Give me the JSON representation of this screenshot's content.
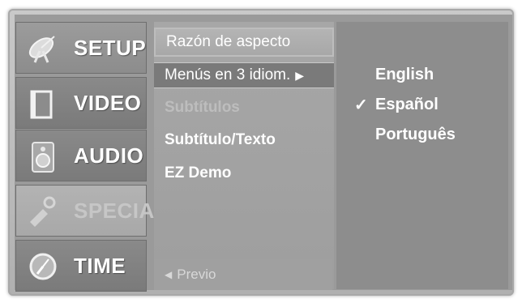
{
  "nav": {
    "items": [
      {
        "label": "SETUP",
        "icon": "satellite-dish-icon"
      },
      {
        "label": "VIDEO",
        "icon": "screen-icon"
      },
      {
        "label": "AUDIO",
        "icon": "speaker-icon"
      },
      {
        "label": "SPECIAL",
        "icon": "key-icon"
      },
      {
        "label": "TIME",
        "icon": "clock-icon"
      }
    ]
  },
  "submenu": {
    "items": [
      {
        "label": "Razón de aspecto"
      },
      {
        "label": "Menús en 3 idiom.",
        "arrow": "▶"
      },
      {
        "label": "Subtítulos"
      },
      {
        "label": "Subtítulo/Texto"
      },
      {
        "label": "EZ Demo"
      }
    ],
    "back": {
      "arrow": "◀",
      "label": "Previo"
    }
  },
  "languages": {
    "options": [
      {
        "label": "English",
        "check": ""
      },
      {
        "label": "Español",
        "check": "✓"
      },
      {
        "label": "Português",
        "check": ""
      }
    ]
  }
}
